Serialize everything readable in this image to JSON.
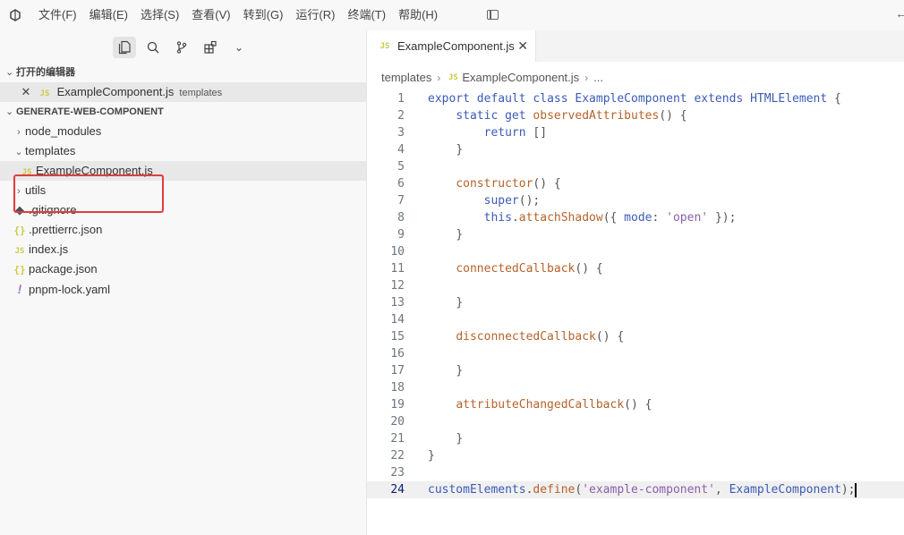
{
  "menu": [
    "文件(F)",
    "编辑(E)",
    "选择(S)",
    "查看(V)",
    "转到(G)",
    "运行(R)",
    "终端(T)",
    "帮助(H)"
  ],
  "sidebar": {
    "open_editors_header": "打开的编辑器",
    "open_editor": {
      "name": "ExampleComponent.js",
      "folder": "templates"
    },
    "project_header": "GENERATE-WEB-COMPONENT",
    "tree": [
      {
        "label": "node_modules",
        "type": "folder-collapsed"
      },
      {
        "label": "templates",
        "type": "folder-expanded"
      },
      {
        "label": "ExampleComponent.js",
        "type": "js"
      },
      {
        "label": "utils",
        "type": "folder-collapsed"
      },
      {
        "label": ".gitignore",
        "type": "git"
      },
      {
        "label": ".prettierrc.json",
        "type": "json"
      },
      {
        "label": "index.js",
        "type": "js"
      },
      {
        "label": "package.json",
        "type": "json"
      },
      {
        "label": "pnpm-lock.yaml",
        "type": "yaml"
      }
    ]
  },
  "icons": {
    "js": "JS",
    "json": "{ }",
    "yaml": "!",
    "close": "×",
    "chevron_right": "›",
    "chevron_down": "⌄"
  },
  "editor": {
    "tab_label": "ExampleComponent.js",
    "breadcrumbs": [
      "templates",
      "ExampleComponent.js",
      "..."
    ],
    "current_line": 24,
    "lines": [
      "export default class ExampleComponent extends HTMLElement {",
      "    static get observedAttributes() {",
      "        return []",
      "    }",
      "",
      "    constructor() {",
      "        super();",
      "        this.attachShadow({ mode: 'open' });",
      "    }",
      "",
      "    connectedCallback() {",
      "",
      "    }",
      "",
      "    disconnectedCallback() {",
      "",
      "    }",
      "",
      "    attributeChangedCallback() {",
      "",
      "    }",
      "}",
      "",
      "customElements.define('example-component', ExampleComponent);"
    ]
  }
}
